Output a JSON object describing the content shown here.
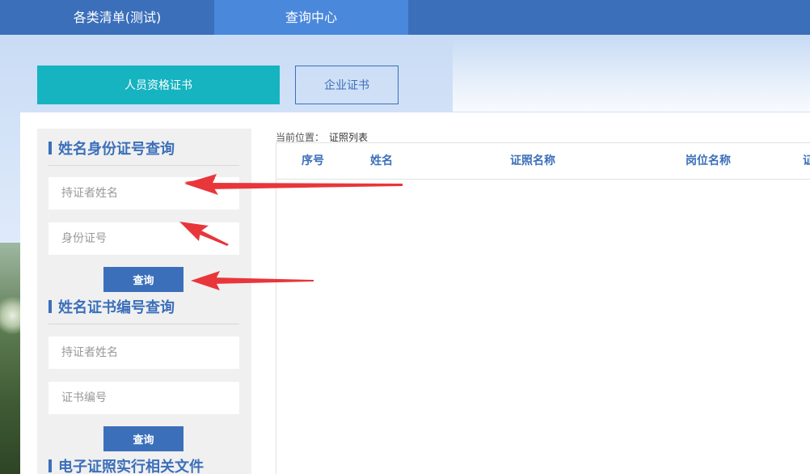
{
  "topnav": {
    "tab_lists": "各类清单(测试)",
    "tab_query": "查询中心"
  },
  "cert_types": {
    "person": "人员资格证书",
    "company": "企业证书"
  },
  "sidebar": {
    "section1": {
      "title": "姓名身份证号查询",
      "name_placeholder": "持证者姓名",
      "id_placeholder": "身份证号",
      "button": "查询"
    },
    "section2": {
      "title": "姓名证书编号查询",
      "name_placeholder": "持证者姓名",
      "cert_placeholder": "证书编号",
      "button": "查询"
    },
    "section3": {
      "title": "电子证照实行相关文件"
    }
  },
  "breadcrumb": {
    "label": "当前位置：",
    "current": "证照列表"
  },
  "table": {
    "columns": [
      "序号",
      "姓名",
      "证照名称",
      "岗位名称",
      "证"
    ]
  },
  "colors": {
    "nav": "#3b6fba",
    "nav_active": "#4a88dc",
    "teal": "#16b3c1",
    "arrow": "#e8363a"
  }
}
